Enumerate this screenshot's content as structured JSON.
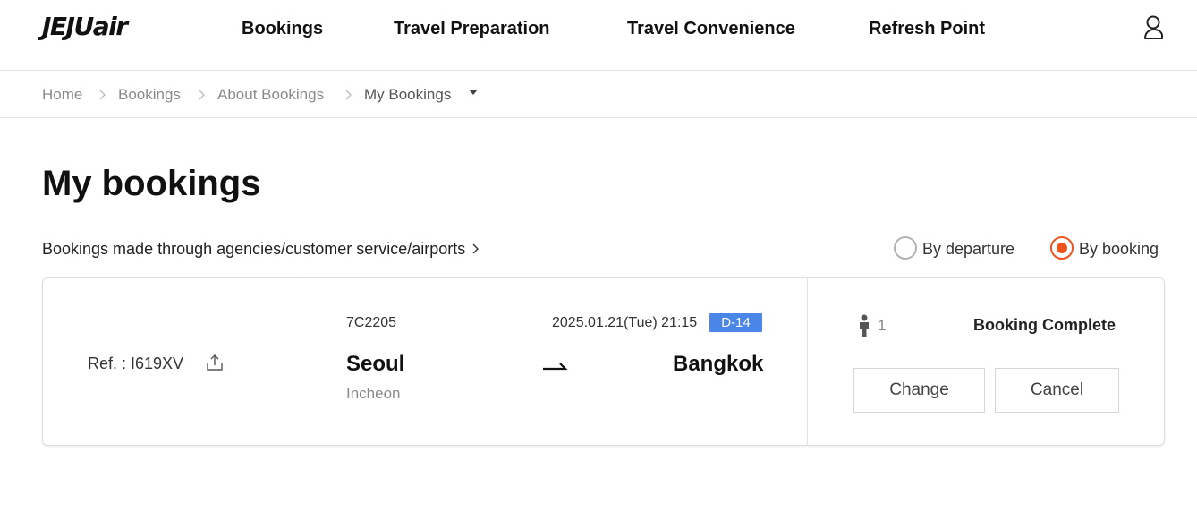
{
  "header": {
    "logo": "JEJUair",
    "nav": [
      "Bookings",
      "Travel Preparation",
      "Travel Convenience",
      "Refresh Point"
    ],
    "user_icon": "user-icon"
  },
  "breadcrumb": {
    "items": [
      "Home",
      "Bookings",
      "About Bookings",
      "My Bookings"
    ]
  },
  "page": {
    "title": "My bookings",
    "agency_link": "Bookings made through agencies/customer service/airports",
    "sort": {
      "options": [
        "By departure",
        "By booking"
      ],
      "selected": "By booking"
    }
  },
  "booking": {
    "ref": "Ref. : I619XV",
    "flight_no": "7C2205",
    "date": "2025.01.21(Tue) 21:15",
    "dday": "D-14",
    "origin_city": "Seoul",
    "origin_airport": "Incheon",
    "destination_city": "Bangkok",
    "passengers": "1",
    "status": "Booking Complete",
    "change_label": "Change",
    "cancel_label": "Cancel"
  },
  "colors": {
    "accent": "#f0541e",
    "dday_badge": "#4a86e8",
    "text_muted": "#8a8a8a"
  }
}
